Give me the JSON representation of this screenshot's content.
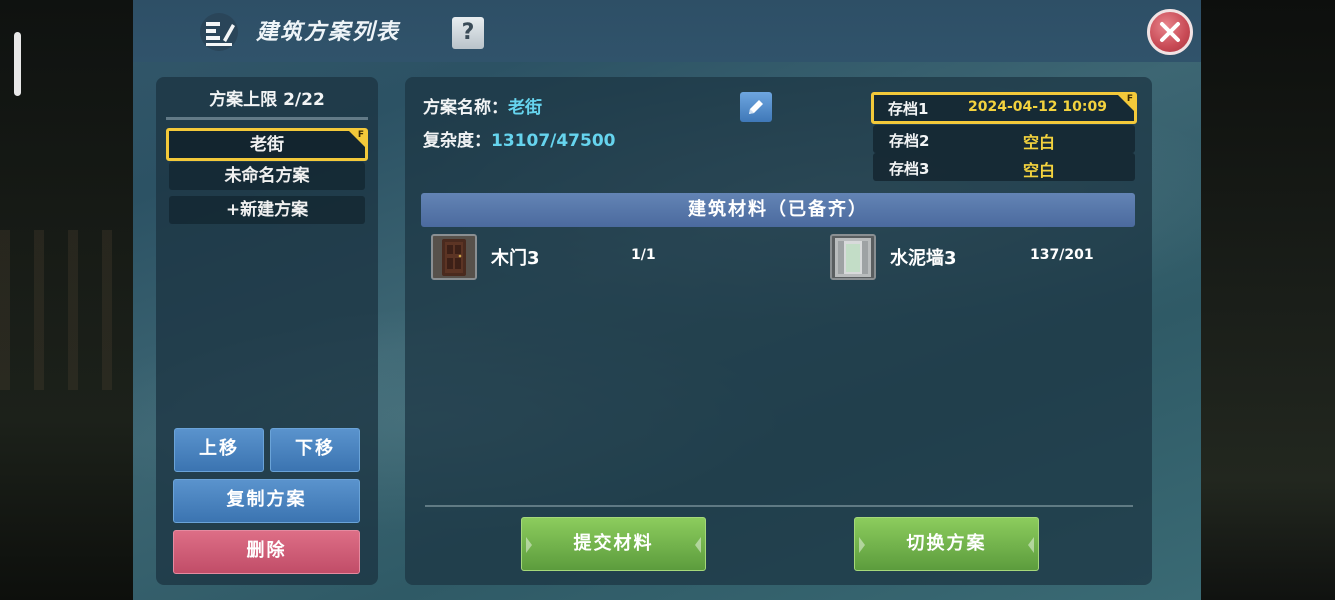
{
  "window": {
    "title": "建筑方案列表",
    "help_label": "?"
  },
  "plans": {
    "limit_text": "方案上限 2/22",
    "items": [
      {
        "label": "老街",
        "badge": "F"
      },
      {
        "label": "未命名方案"
      },
      {
        "label": "+新建方案"
      }
    ],
    "move_up_label": "上移",
    "move_down_label": "下移",
    "copy_label": "复制方案",
    "delete_label": "删除"
  },
  "detail": {
    "name_label": "方案名称：",
    "name_value": "老街",
    "complexity_label": "复杂度：",
    "complexity_value": "13107/47500",
    "saves": [
      {
        "label": "存档1",
        "value": "2024-04-12 10:09",
        "badge": "F"
      },
      {
        "label": "存档2",
        "value": "空白"
      },
      {
        "label": "存档3",
        "value": "空白"
      }
    ],
    "materials_header": "建筑材料（已备齐）",
    "materials": [
      {
        "name": "木门3",
        "count": "1/1",
        "icon": "wooden-door-icon"
      },
      {
        "name": "水泥墙3",
        "count": "137/201",
        "icon": "cement-wall-icon"
      }
    ],
    "submit_label": "提交材料",
    "switch_label": "切换方案"
  },
  "colors": {
    "accent_yellow": "#f3c93a",
    "value_cyan": "#66d4ee",
    "button_blue": "#4a83c0",
    "button_red": "#c94f6a",
    "button_green": "#6fae48"
  }
}
